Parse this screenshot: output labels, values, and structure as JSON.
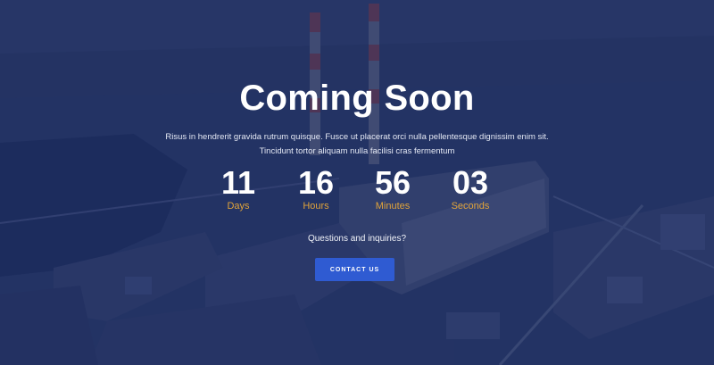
{
  "hero": {
    "title": "Coming Soon",
    "description": "Risus in hendrerit gravida rutrum quisque. Fusce ut placerat orci nulla pellentesque dignissim enim sit. Tincidunt tortor aliquam nulla facilisi cras fermentum"
  },
  "countdown": [
    {
      "value": "11",
      "label": "Days"
    },
    {
      "value": "16",
      "label": "Hours"
    },
    {
      "value": "56",
      "label": "Minutes"
    },
    {
      "value": "03",
      "label": "Seconds"
    }
  ],
  "contact": {
    "prompt": "Questions and inquiries?",
    "button_label": "CONTACT US"
  },
  "colors": {
    "overlay": "#1e2d64",
    "accent_label": "#e0a33a",
    "button": "#2f5bd2",
    "text": "#ffffff"
  }
}
